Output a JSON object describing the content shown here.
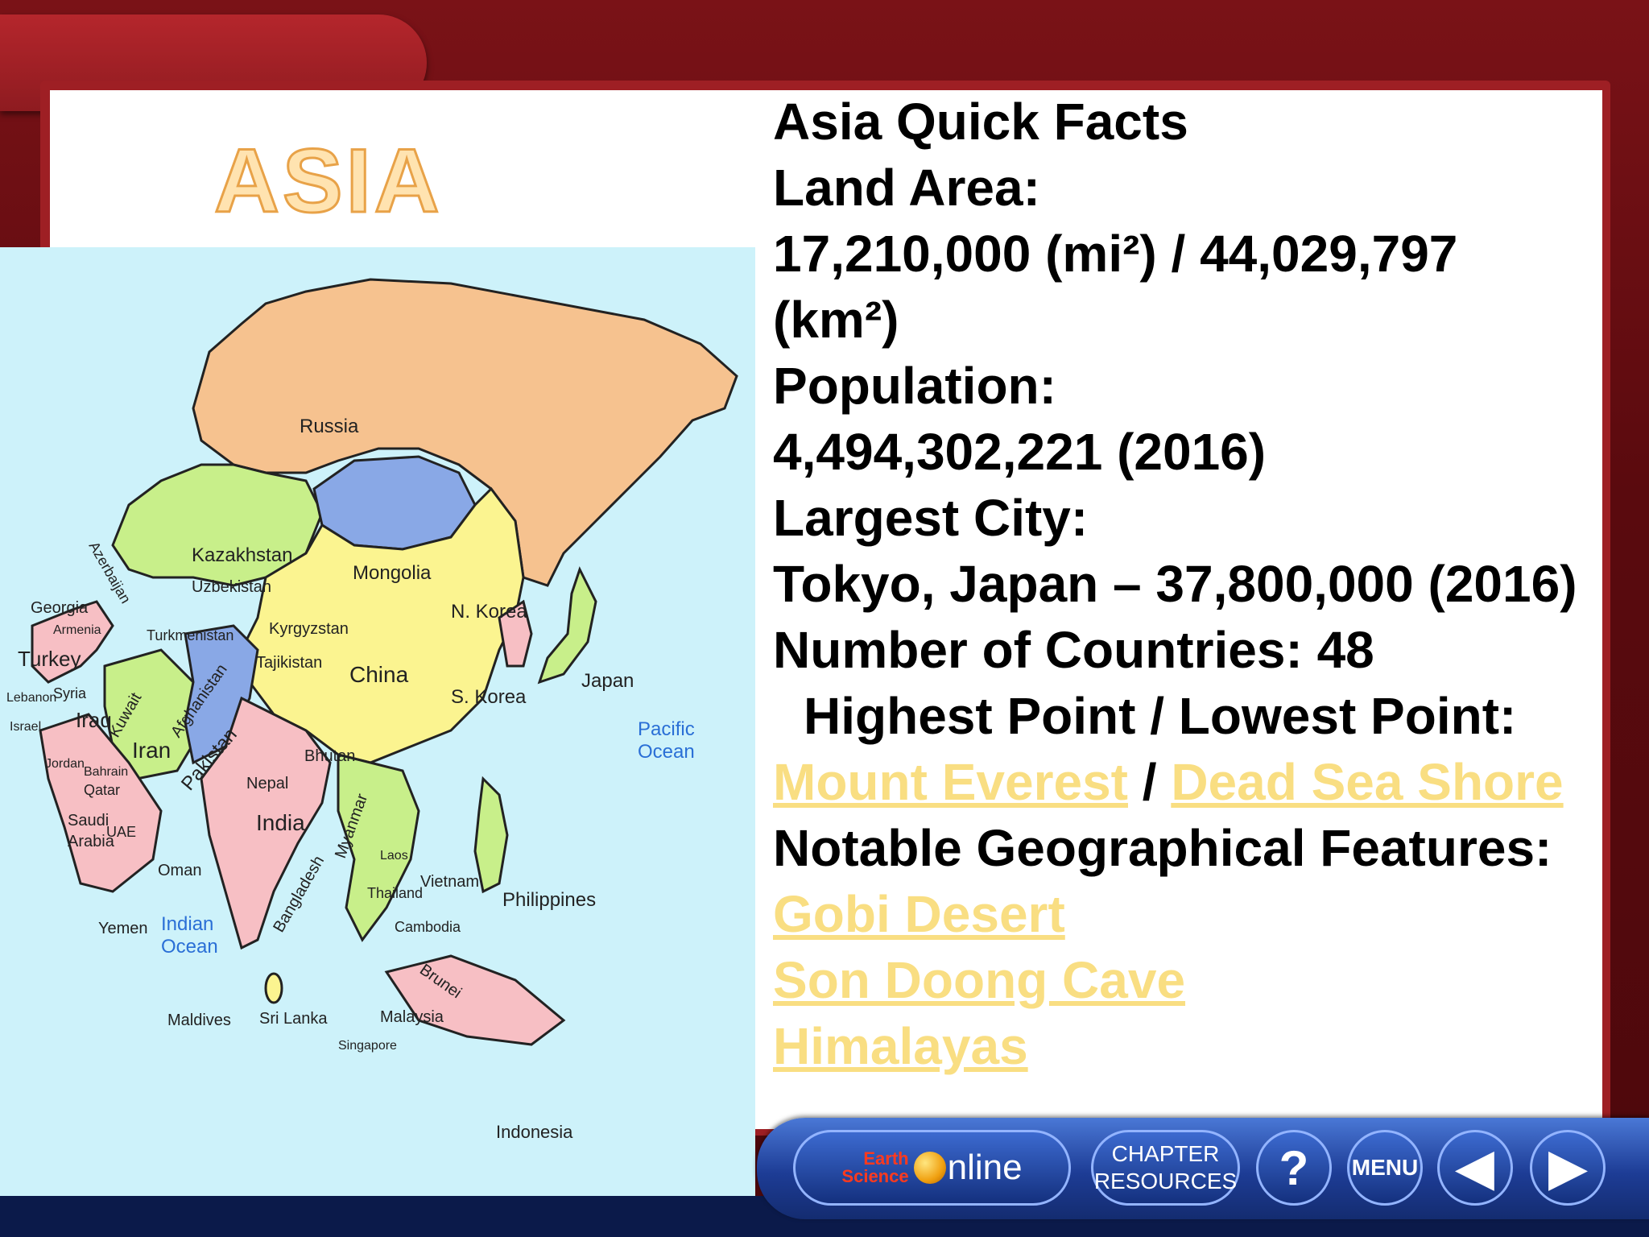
{
  "title": "ASIA",
  "facts": {
    "heading": "Asia  Quick Facts",
    "land_area_label": "Land Area:",
    "land_area_value_1": "17,210,000 (mi²) / 44,029,797",
    "land_area_value_2": "(km²)",
    "population_label": "Population:",
    "population_value": "4,494,302,221 (2016)",
    "largest_city_label": "Largest City:",
    "largest_city_value": "Tokyo, Japan – 37,800,000 (2016)",
    "countries": "Number of Countries: 48",
    "high_low_label": "Highest Point / Lowest Point:",
    "highest_link": "Mount Everest",
    "separator": " / ",
    "lowest_link": "Dead Sea Shore",
    "features_label": "Notable Geographical Features:",
    "features": [
      "Gobi Desert",
      "Son Doong Cave",
      "Himalayas"
    ]
  },
  "map": {
    "countries": {
      "russia": "Russia",
      "kazakhstan": "Kazakhstan",
      "mongolia": "Mongolia",
      "uzbekistan": "Uzbekistan",
      "georgia": "Georgia",
      "armenia": "Armenia",
      "azerbaijan": "Azerbaijan",
      "turkey": "Turkey",
      "turkmenistan": "Turkmenistan",
      "kyrgyzstan": "Kyrgyzstan",
      "tajikistan": "Tajikistan",
      "china": "China",
      "n_korea": "N. Korea",
      "s_korea": "S. Korea",
      "japan": "Japan",
      "lebanon": "Lebanon",
      "syria": "Syria",
      "israel": "Israel",
      "iraq": "Iraq",
      "kuwait": "Kuwait",
      "iran": "Iran",
      "afghanistan": "Afghanistan",
      "pakistan": "Pakistan",
      "jordan": "Jordan",
      "bahrain": "Bahrain",
      "qatar": "Qatar",
      "saudi": "Saudi",
      "arabia": "Arabia",
      "uae": "UAE",
      "oman": "Oman",
      "yemen": "Yemen",
      "nepal": "Nepal",
      "bhutan": "Bhutan",
      "india": "India",
      "bangladesh": "Bangladesh",
      "myanmar": "Myanmar",
      "laos": "Laos",
      "thailand": "Thailand",
      "vietnam": "Vietnam",
      "cambodia": "Cambodia",
      "philippines": "Philippines",
      "brunei": "Brunei",
      "malaysia": "Malaysia",
      "singapore": "Singapore",
      "indonesia": "Indonesia",
      "sri_lanka": "Sri Lanka",
      "maldives": "Maldives"
    },
    "oceans": {
      "indian_1": "Indian",
      "indian_2": "Ocean",
      "pacific_1": "Pacific",
      "pacific_2": "Ocean"
    }
  },
  "nav": {
    "es_logo_1": "Earth",
    "es_logo_2": "Science",
    "es_text": "nline",
    "chapter_1": "CHAPTER",
    "chapter_2": "RESOURCES",
    "help": "?",
    "menu": "MENU",
    "back": "◀",
    "forward": "▶"
  },
  "colors": {
    "link": "#f9de82",
    "russia": "#f6c28f",
    "kazakhstan": "#c8ef8a",
    "mongolia": "#89a8e6",
    "china": "#fbf490",
    "india": "#f7bfc4",
    "ocean": "#cdf2fa"
  }
}
